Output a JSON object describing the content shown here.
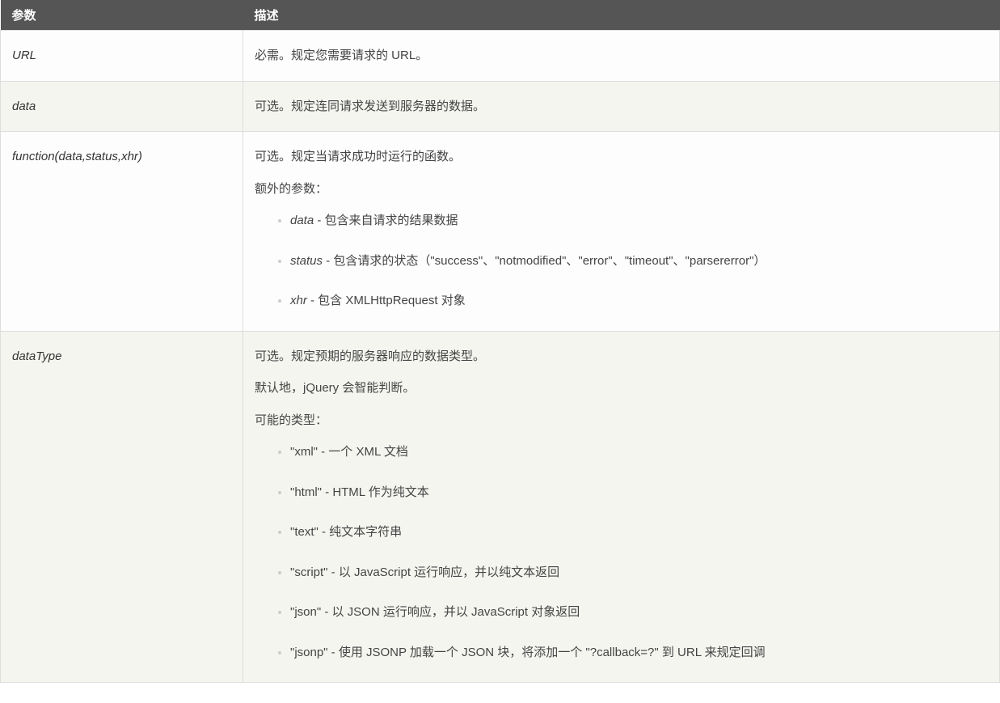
{
  "headers": {
    "param": "参数",
    "desc": "描述"
  },
  "rows": [
    {
      "param": "URL",
      "desc_lines": [
        "必需。规定您需要请求的 URL。"
      ],
      "list": []
    },
    {
      "param": "data",
      "desc_lines": [
        "可选。规定连同请求发送到服务器的数据。"
      ],
      "list": []
    },
    {
      "param": "function(data,status,xhr)",
      "desc_lines": [
        "可选。规定当请求成功时运行的函数。",
        "额外的参数："
      ],
      "list": [
        {
          "html": "<em>data</em> - 包含来自请求的结果数据"
        },
        {
          "html": "<em>status</em> - 包含请求的状态（\"success\"、\"notmodified\"、\"error\"、\"timeout\"、\"parsererror\"）"
        },
        {
          "html": "<em>xhr</em> - 包含 XMLHttpRequest 对象"
        }
      ]
    },
    {
      "param": "dataType",
      "desc_lines": [
        "可选。规定预期的服务器响应的数据类型。",
        "默认地，jQuery 会智能判断。",
        "可能的类型："
      ],
      "list": [
        {
          "html": "\"xml\" - 一个 XML 文档"
        },
        {
          "html": "\"html\" - HTML 作为纯文本"
        },
        {
          "html": "\"text\" - 纯文本字符串"
        },
        {
          "html": "\"script\" - 以 JavaScript 运行响应，并以纯文本返回"
        },
        {
          "html": "\"json\" - 以 JSON 运行响应，并以 JavaScript 对象返回"
        },
        {
          "html": "\"jsonp\" - 使用 JSONP 加载一个 JSON 块，将添加一个 \"?callback=?\" 到 URL 来规定回调"
        }
      ]
    }
  ]
}
